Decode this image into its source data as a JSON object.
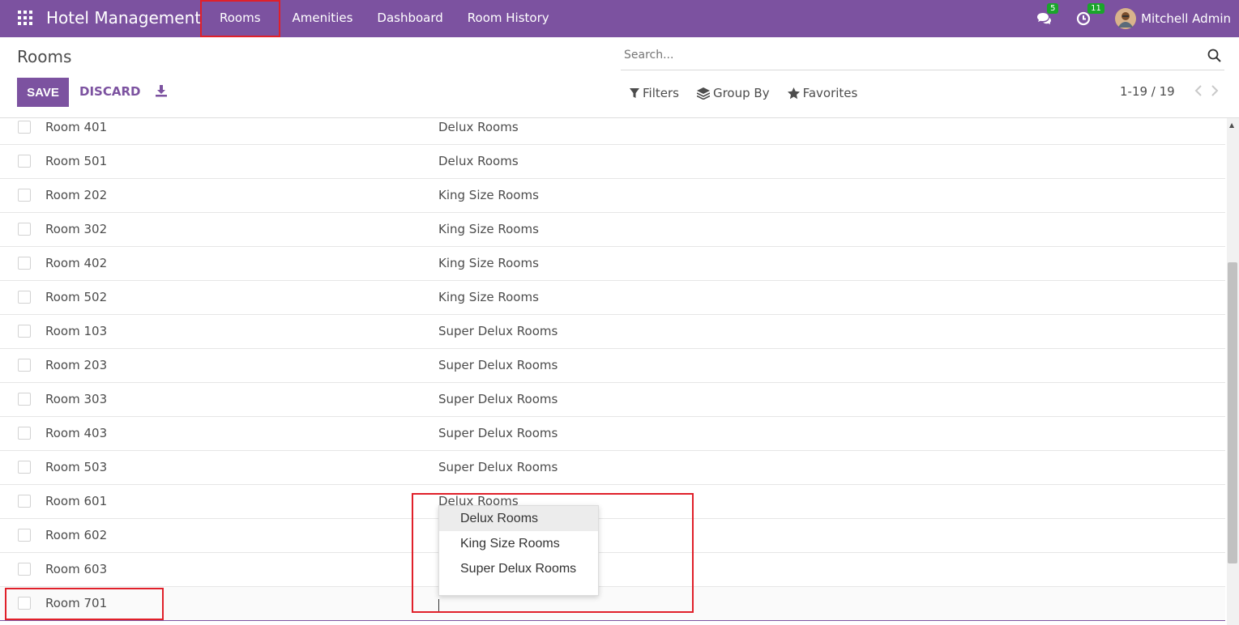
{
  "app": {
    "title": "Hotel Management"
  },
  "nav": {
    "items": [
      {
        "label": "Rooms"
      },
      {
        "label": "Amenities"
      },
      {
        "label": "Dashboard"
      },
      {
        "label": "Room History"
      }
    ]
  },
  "systray": {
    "messages_count": "5",
    "activities_count": "11",
    "user_name": "Mitchell Admin"
  },
  "control_panel": {
    "breadcrumb": "Rooms",
    "save_label": "SAVE",
    "discard_label": "DISCARD",
    "search_placeholder": "Search...",
    "filters_label": "Filters",
    "group_by_label": "Group By",
    "favorites_label": "Favorites",
    "pager": "1-19 / 19"
  },
  "rows": [
    {
      "name": "Room 401",
      "type": "Delux Rooms"
    },
    {
      "name": "Room 501",
      "type": "Delux Rooms"
    },
    {
      "name": "Room 202",
      "type": "King Size Rooms"
    },
    {
      "name": "Room 302",
      "type": "King Size Rooms"
    },
    {
      "name": "Room 402",
      "type": "King Size Rooms"
    },
    {
      "name": "Room 502",
      "type": "King Size Rooms"
    },
    {
      "name": "Room 103",
      "type": "Super Delux Rooms"
    },
    {
      "name": "Room 203",
      "type": "Super Delux Rooms"
    },
    {
      "name": "Room 303",
      "type": "Super Delux Rooms"
    },
    {
      "name": "Room 403",
      "type": "Super Delux Rooms"
    },
    {
      "name": "Room 503",
      "type": "Super Delux Rooms"
    },
    {
      "name": "Room 601",
      "type": "Delux Rooms"
    },
    {
      "name": "Room 602",
      "type": ""
    },
    {
      "name": "Room 603",
      "type": ""
    },
    {
      "name": "Room 701",
      "type": ""
    }
  ],
  "dropdown": {
    "options": [
      "Delux Rooms",
      "King Size Rooms",
      "Super Delux Rooms"
    ],
    "active_option": "Delux Rooms"
  },
  "colors": {
    "brand": "#7c52a0",
    "badge": "#1aa52b",
    "annotation": "#e0202a"
  }
}
